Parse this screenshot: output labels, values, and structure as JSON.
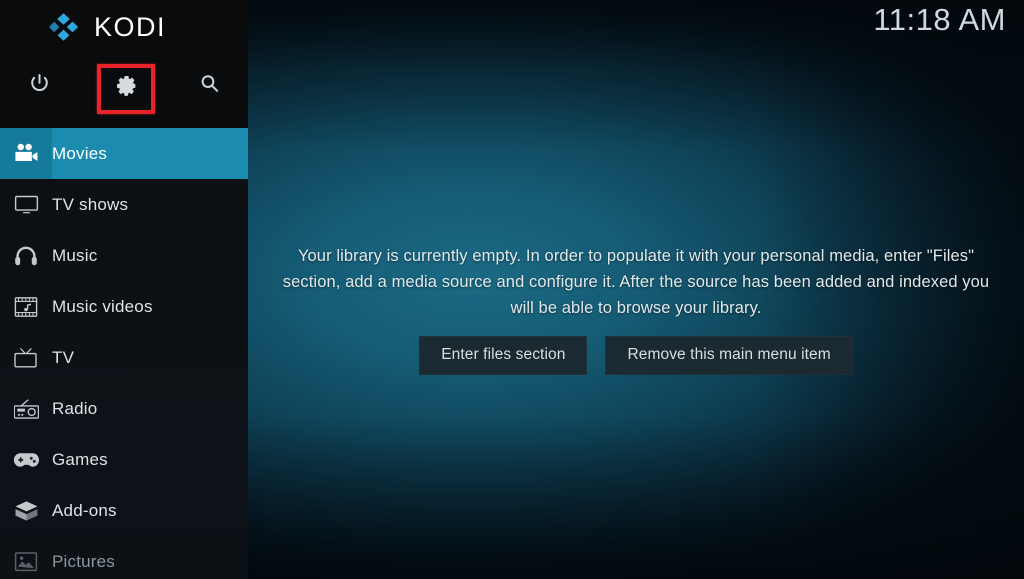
{
  "app": {
    "title": "KODI",
    "logo_color": "#30a8dd",
    "accent_color": "#1b8cb0",
    "highlight_color": "#e8242a"
  },
  "header": {
    "clock": "11:18 AM",
    "icons": [
      {
        "name": "power-icon",
        "label": "Power"
      },
      {
        "name": "gear-icon",
        "label": "Settings"
      },
      {
        "name": "search-icon",
        "label": "Search"
      }
    ]
  },
  "sidebar": {
    "items": [
      {
        "label": "Movies",
        "icon": "movie-camera-icon",
        "selected": true,
        "dim": false
      },
      {
        "label": "TV shows",
        "icon": "tv-monitor-icon",
        "selected": false,
        "dim": false
      },
      {
        "label": "Music",
        "icon": "headphones-icon",
        "selected": false,
        "dim": false
      },
      {
        "label": "Music videos",
        "icon": "music-video-icon",
        "selected": false,
        "dim": false
      },
      {
        "label": "TV",
        "icon": "television-icon",
        "selected": false,
        "dim": false
      },
      {
        "label": "Radio",
        "icon": "radio-icon",
        "selected": false,
        "dim": false
      },
      {
        "label": "Games",
        "icon": "gamepad-icon",
        "selected": false,
        "dim": false
      },
      {
        "label": "Add-ons",
        "icon": "addon-box-icon",
        "selected": false,
        "dim": false
      },
      {
        "label": "Pictures",
        "icon": "picture-icon",
        "selected": false,
        "dim": true
      }
    ]
  },
  "main": {
    "empty_message": "Your library is currently empty. In order to populate it with your personal media, enter \"Files\" section, add a media source and configure it. After the source has been added and indexed you will be able to browse your library.",
    "buttons": [
      {
        "label": "Enter files section"
      },
      {
        "label": "Remove this main menu item"
      }
    ]
  }
}
